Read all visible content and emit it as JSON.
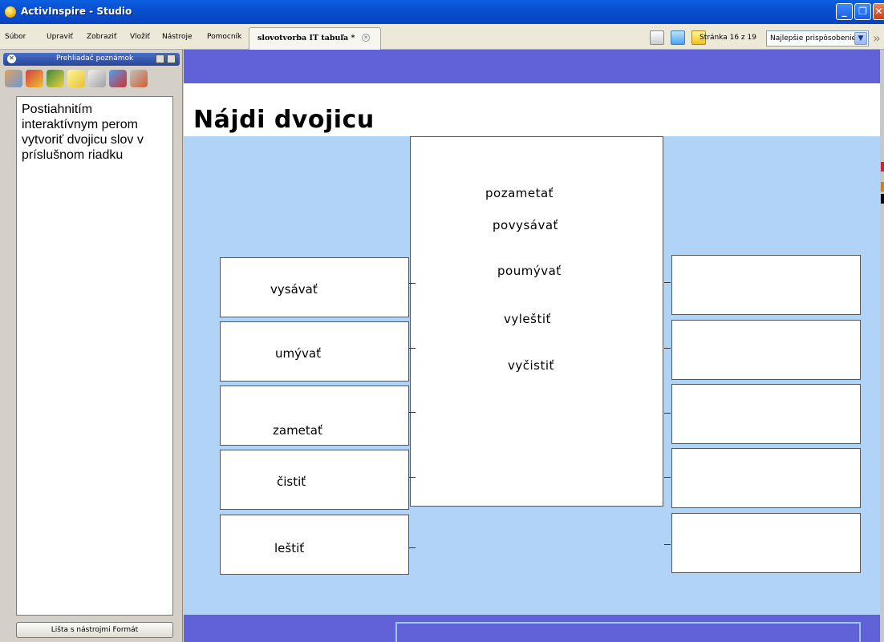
{
  "window": {
    "title": "ActivInspire - Studio"
  },
  "menu": {
    "items": [
      "Súbor",
      "Upraviť",
      "Zobraziť",
      "Vložiť",
      "Nástroje",
      "Pomocník"
    ]
  },
  "document_tab": {
    "label": "slovotvorba IT tabuľa *"
  },
  "toolbar": {
    "page_info": "Stránka 16 z 19",
    "zoom_value": "Najlepšie prispôsobenie"
  },
  "left_panel": {
    "title": "Prehliadač poznámok",
    "notes_text": "Postiahnitím interaktívnym perom vytvoriť dvojicu slov v príslušnom riadku",
    "format_button": "Lišta s nástrojmi Formát"
  },
  "page": {
    "heading": "Nájdi dvojicu",
    "left_words": [
      "vysávať",
      "umývať",
      "zametať",
      "čistiť",
      "leštiť"
    ],
    "center_words": [
      "pozametať",
      "povysávať",
      "poumývať",
      "vyleštiť",
      "vyčistiť"
    ],
    "right_boxes": [
      "",
      "",
      "",
      "",
      ""
    ]
  },
  "colors": {
    "title_bar": "#0a4fd0",
    "top_band": "#6161d8",
    "canvas_bg": "#b0d3f7"
  }
}
